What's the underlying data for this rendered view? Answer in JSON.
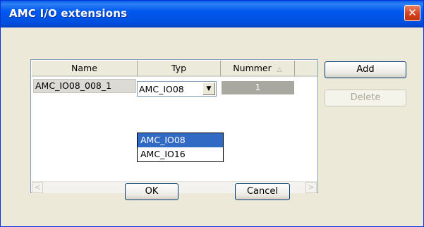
{
  "window": {
    "title": "AMC I/O extensions",
    "close_label": "✕"
  },
  "table": {
    "columns": [
      "Name",
      "Typ",
      "Nummer",
      ""
    ],
    "sort_icon": "△",
    "rows": [
      {
        "name": "AMC_IO08_008_1",
        "typ": "AMC_IO08",
        "nummer": "1"
      }
    ]
  },
  "dropdown": {
    "arrow": "▼",
    "options": [
      "AMC_IO08",
      "AMC_IO16"
    ],
    "selected": "AMC_IO08"
  },
  "scrollbar": {
    "left_arrow": "<",
    "right_arrow": ">"
  },
  "buttons": {
    "add": "Add",
    "delete": "Delete",
    "ok": "OK",
    "cancel": "Cancel"
  },
  "colors": {
    "titlebar": "#0058ee",
    "selection": "#316ac5",
    "close": "#d5421f"
  }
}
